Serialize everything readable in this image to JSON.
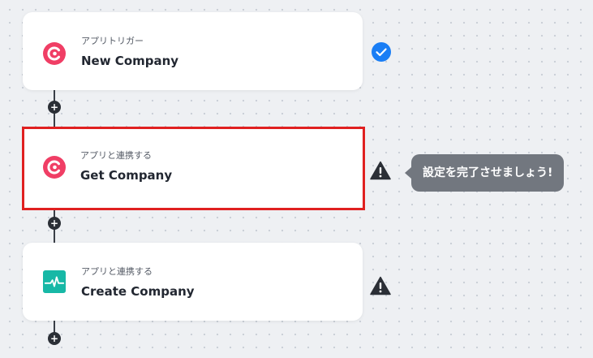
{
  "flow": {
    "steps": [
      {
        "type_label": "アプリトリガー",
        "title": "New Company",
        "app_icon": "c-logo-icon",
        "status": "completed",
        "status_icon": "check-circle-icon"
      },
      {
        "type_label": "アプリと連携する",
        "title": "Get Company",
        "app_icon": "c-logo-icon",
        "status": "incomplete",
        "status_icon": "warning-icon",
        "selected": true
      },
      {
        "type_label": "アプリと連携する",
        "title": "Create Company",
        "app_icon": "pulse-logo-icon",
        "status": "incomplete",
        "status_icon": "warning-icon"
      }
    ],
    "add_step_symbol": "+"
  },
  "tooltip": {
    "text": "設定を完了させましょう!"
  },
  "colors": {
    "background": "#eef0f3",
    "card": "#ffffff",
    "selected_border": "#e02020",
    "c_logo": "#f03e65",
    "pulse_logo": "#17b8a6",
    "check": "#1a7ef5",
    "warning": "#2b2f36",
    "tooltip_bg": "#72777f"
  }
}
